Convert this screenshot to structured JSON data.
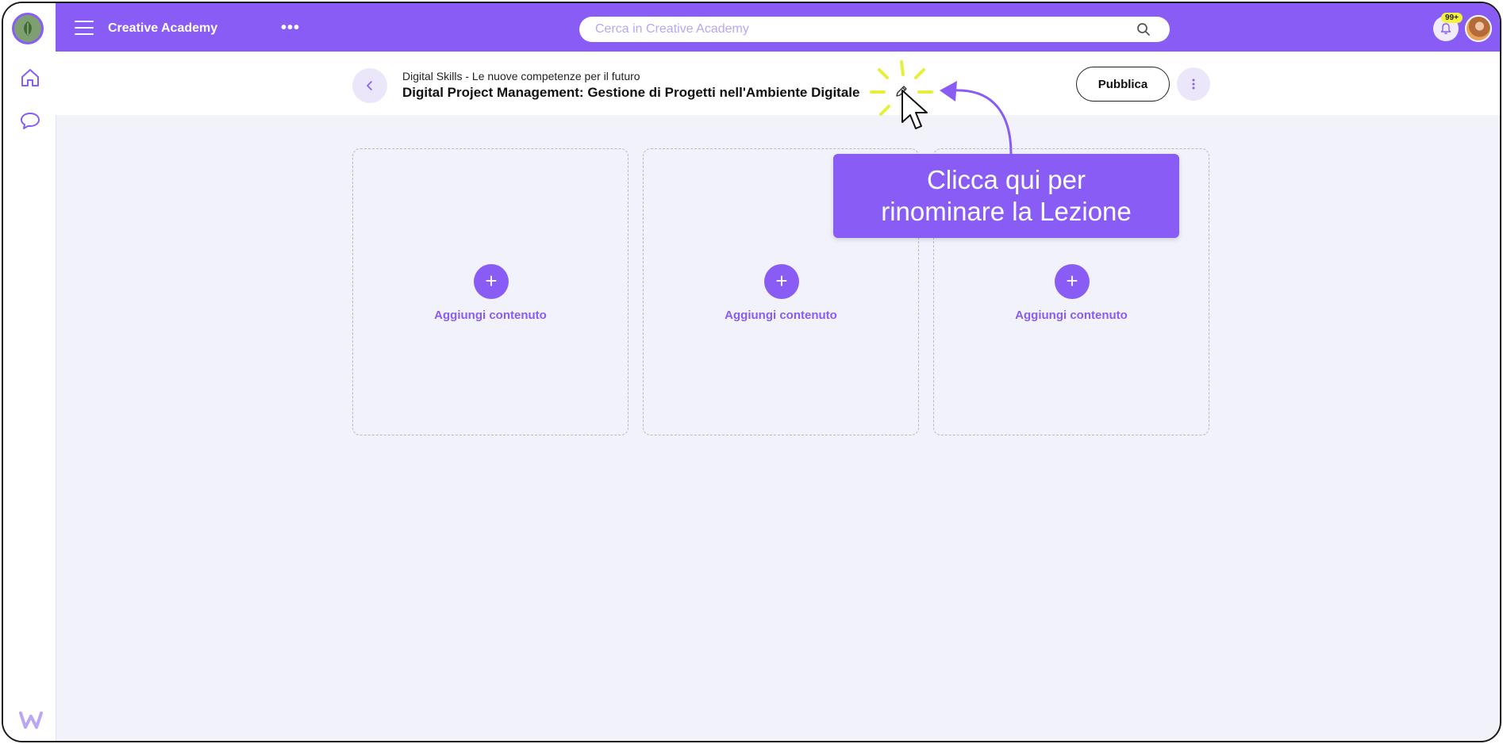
{
  "app": {
    "brand": "Creative Academy",
    "more_label": "•••"
  },
  "search": {
    "placeholder": "Cerca in Creative Academy"
  },
  "notifications": {
    "badge": "99+"
  },
  "lesson": {
    "breadcrumb": "Digital Skills - Le nuove competenze per il futuro",
    "title": "Digital Project Management: Gestione di Progetti nell'Ambiente Digitale"
  },
  "actions": {
    "publish_label": "Pubblica"
  },
  "cards": [
    {
      "plus": "+",
      "label": "Aggiungi contenuto"
    },
    {
      "plus": "+",
      "label": "Aggiungi contenuto"
    },
    {
      "plus": "+",
      "label": "Aggiungi contenuto"
    }
  ],
  "tutorial": {
    "line1": "Clicca qui per",
    "line2": "rinominare la Lezione"
  },
  "colors": {
    "accent": "#8a5cf6",
    "background": "#f2f2fa",
    "highlight": "#e6f03a"
  },
  "icons": [
    "menu-icon",
    "home-icon",
    "chat-icon",
    "search-icon",
    "bell-icon",
    "chevron-left-icon",
    "pencil-icon",
    "kebab-icon",
    "plus-icon",
    "cursor-icon"
  ]
}
